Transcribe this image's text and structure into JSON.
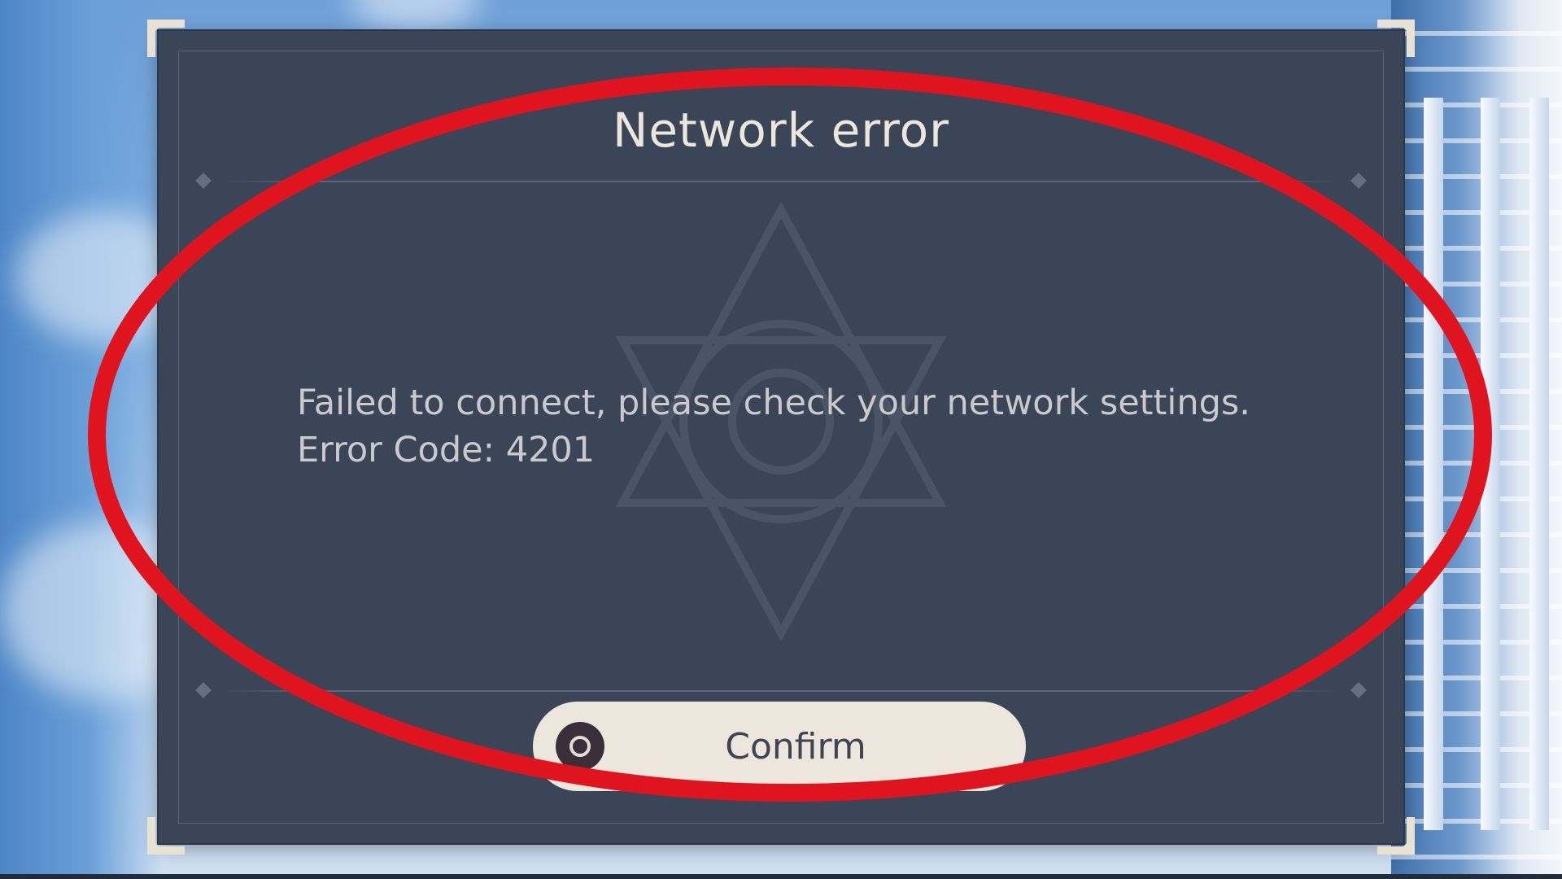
{
  "dialog": {
    "title": "Network error",
    "message_line1": "Failed to connect, please check your network settings.",
    "message_line2": "Error Code: 4201",
    "confirm_label": "Confirm"
  },
  "colors": {
    "panel": "#3b4558",
    "button": "#ece6dc",
    "annotation": "#e0141e"
  },
  "icons": [
    "confirm-circle-icon",
    "emblem-icon",
    "corner-ornament-icon"
  ]
}
